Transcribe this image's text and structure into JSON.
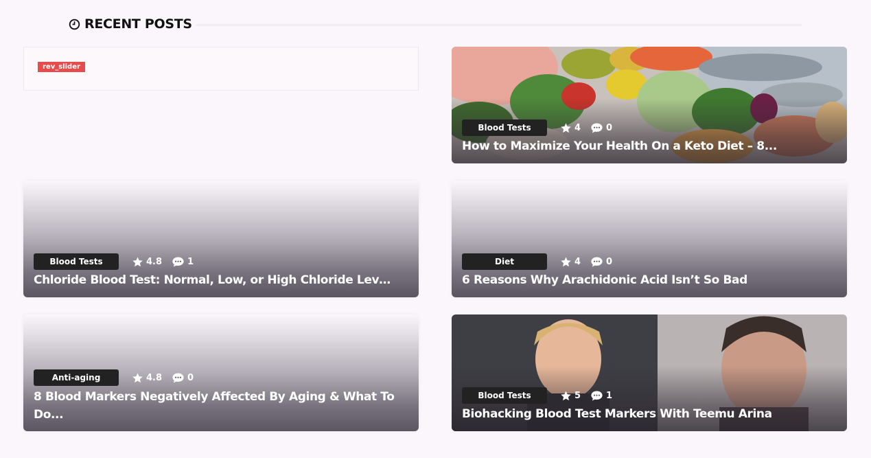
{
  "section": {
    "title": "RECENT POSTS",
    "icon": "clock-icon"
  },
  "slider": {
    "badge": "rev_slider"
  },
  "posts": [
    {
      "category": "Blood Tests",
      "rating": "4",
      "comments": "0",
      "title": "How to Maximize Your Health On a Keto Diet – 8..."
    },
    {
      "category": "Blood Tests",
      "rating": "4.8",
      "comments": "1",
      "title": "Chloride Blood Test: Normal, Low, or High Chloride Levels?"
    },
    {
      "category": "Diet",
      "rating": "4",
      "comments": "0",
      "title": "6 Reasons Why Arachidonic Acid Isn’t So Bad"
    },
    {
      "category": "Anti-aging",
      "rating": "4.8",
      "comments": "0",
      "title": "8 Blood Markers Negatively Affected By Aging & What To Do..."
    },
    {
      "category": "Blood Tests",
      "rating": "5",
      "comments": "1",
      "title": "Biohacking Blood Test Markers With Teemu Arina"
    }
  ],
  "colors": {
    "background": "#fbf6fb",
    "badge": "#e64c4c",
    "category_bg": "#222222"
  }
}
